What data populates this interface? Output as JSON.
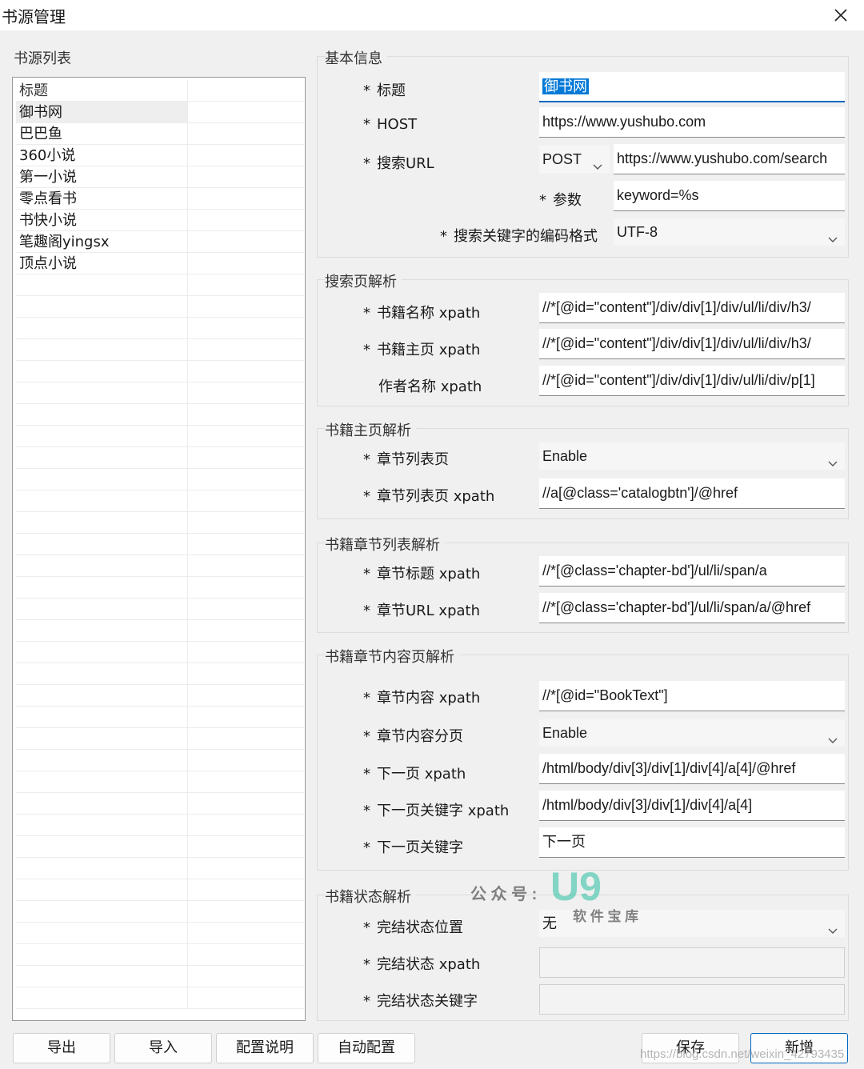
{
  "window": {
    "title": "书源管理"
  },
  "left_panel": {
    "legend": "书源列表",
    "header": "标题",
    "items": [
      "御书网",
      "巴巴鱼",
      "360小说",
      "第一小说",
      "零点看书",
      "书快小说",
      "笔趣阁yingsx",
      "顶点小说"
    ]
  },
  "basic": {
    "legend": "基本信息",
    "title_label": "标题",
    "title_value": "御书网",
    "host_label": "HOST",
    "host_value": "https://www.yushubo.com",
    "url_label": "搜索URL",
    "method": "POST",
    "url_value": "https://www.yushubo.com/search",
    "params_label": "参数",
    "params_value": "keyword=%s",
    "encoding_label": "搜索关键字的编码格式",
    "encoding_value": "UTF-8"
  },
  "search": {
    "legend": "搜索页解析",
    "name_label": "书籍名称 xpath",
    "name_value": "//*[@id=\"content\"]/div/div[1]/div/ul/li/div/h3/",
    "home_label": "书籍主页 xpath",
    "home_value": "//*[@id=\"content\"]/div/div[1]/div/ul/li/div/h3/",
    "author_label": "作者名称 xpath",
    "author_value": "//*[@id=\"content\"]/div/div[1]/div/ul/li/div/p[1]"
  },
  "book_home": {
    "legend": "书籍主页解析",
    "list_page_label": "章节列表页",
    "list_page_value": "Enable",
    "list_xpath_label": "章节列表页 xpath",
    "list_xpath_value": "//a[@class='catalogbtn']/@href"
  },
  "chapter_list": {
    "legend": "书籍章节列表解析",
    "title_label": "章节标题 xpath",
    "title_value": "//*[@class='chapter-bd']/ul/li/span/a",
    "url_label": "章节URL  xpath",
    "url_value": "//*[@class='chapter-bd']/ul/li/span/a/@href"
  },
  "chapter_content": {
    "legend": "书籍章节内容页解析",
    "content_label": "章节内容 xpath",
    "content_value": "//*[@id=\"BookText\"]",
    "paging_label": "章节内容分页",
    "paging_value": "Enable",
    "next_label": "下一页 xpath",
    "next_value": "/html/body/div[3]/div[1]/div[4]/a[4]/@href",
    "next_kw_xpath_label": "下一页关键字 xpath",
    "next_kw_xpath_value": "/html/body/div[3]/div[1]/div[4]/a[4]",
    "next_kw_label": "下一页关键字",
    "next_kw_value": "下一页"
  },
  "status": {
    "legend": "书籍状态解析",
    "pos_label": "完结状态位置",
    "pos_value": "无",
    "xpath_label": "完结状态 xpath",
    "xpath_value": "",
    "kw_label": "完结状态关键字",
    "kw_value": ""
  },
  "buttons": {
    "export": "导出",
    "import": "导入",
    "config_help": "配置说明",
    "auto_config": "自动配置",
    "save": "保存",
    "new": "新增"
  },
  "star": "*",
  "watermark": {
    "gzh": "公 众 号 :",
    "logo": "U9",
    "site": "软 件 宝 库",
    "url": "https://blog.csdn.net/weixin_42793435"
  },
  "colors": {
    "accent": "#0067c0",
    "selection": "#0078d7"
  }
}
